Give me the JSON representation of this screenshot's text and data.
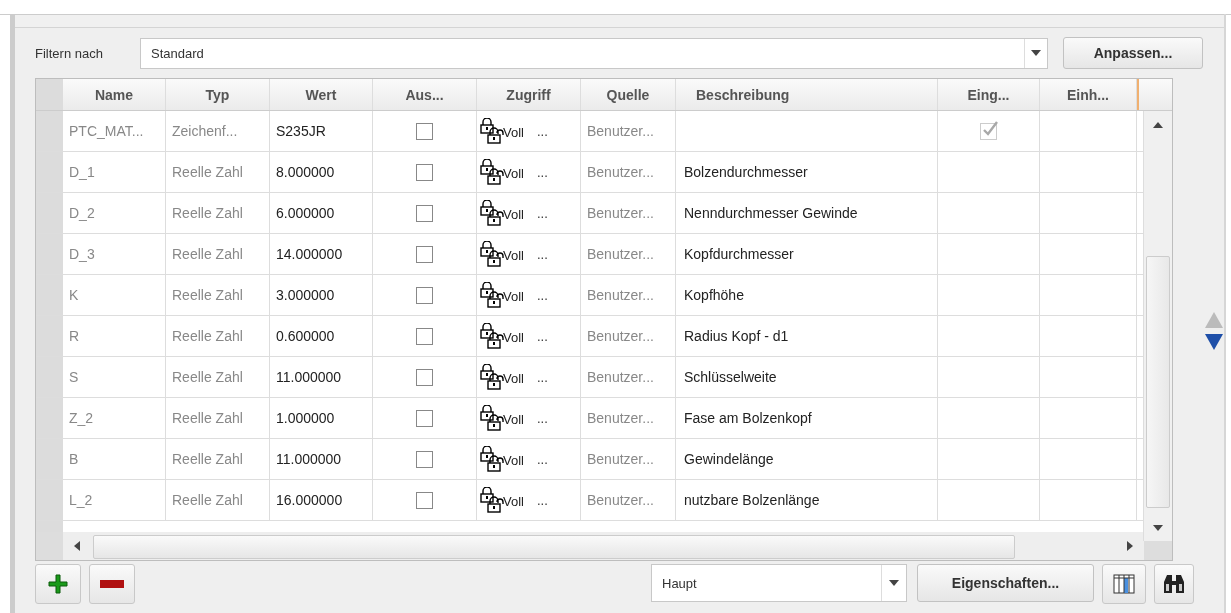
{
  "filter": {
    "label": "Filtern nach",
    "value": "Standard",
    "button": "Anpassen..."
  },
  "table": {
    "columns": [
      "Name",
      "Typ",
      "Wert",
      "Aus...",
      "Zugriff",
      "Quelle",
      "Beschreibung",
      "Eing...",
      "Einh..."
    ],
    "rows": [
      {
        "name": "PTC_MAT...",
        "type": "Zeichenf...",
        "value": "S235JR",
        "designated": false,
        "access": "Voll",
        "source": "Benutzer...",
        "description": "",
        "input": {
          "checked": true,
          "disabled": true
        }
      },
      {
        "name": "D_1",
        "type": "Reelle Zahl",
        "value": "8.000000",
        "designated": false,
        "access": "Voll",
        "source": "Benutzer...",
        "description": "Bolzendurchmesser"
      },
      {
        "name": "D_2",
        "type": "Reelle Zahl",
        "value": "6.000000",
        "designated": false,
        "access": "Voll",
        "source": "Benutzer...",
        "description": "Nenndurchmesser Gewinde"
      },
      {
        "name": "D_3",
        "type": "Reelle Zahl",
        "value": "14.000000",
        "designated": false,
        "access": "Voll",
        "source": "Benutzer...",
        "description": "Kopfdurchmesser"
      },
      {
        "name": "K",
        "type": "Reelle Zahl",
        "value": "3.000000",
        "designated": false,
        "access": "Voll",
        "source": "Benutzer...",
        "description": "Kopfhöhe"
      },
      {
        "name": "R",
        "type": "Reelle Zahl",
        "value": "0.600000",
        "designated": false,
        "access": "Voll",
        "source": "Benutzer...",
        "description": "Radius Kopf - d1"
      },
      {
        "name": "S",
        "type": "Reelle Zahl",
        "value": "11.000000",
        "designated": false,
        "access": "Voll",
        "source": "Benutzer...",
        "description": "Schlüsselweite"
      },
      {
        "name": "Z_2",
        "type": "Reelle Zahl",
        "value": "1.000000",
        "designated": false,
        "access": "Voll",
        "source": "Benutzer...",
        "description": "Fase am Bolzenkopf"
      },
      {
        "name": "B",
        "type": "Reelle Zahl",
        "value": "11.000000",
        "designated": false,
        "access": "Voll",
        "source": "Benutzer...",
        "description": "Gewindelänge"
      },
      {
        "name": "L_2",
        "type": "Reelle Zahl",
        "value": "16.000000",
        "designated": false,
        "access": "Voll",
        "source": "Benutzer...",
        "description": "nutzbare Bolzenlänge"
      }
    ],
    "more_button": "..."
  },
  "bottom": {
    "view": "Haupt",
    "properties_button": "Eigenschaften..."
  }
}
